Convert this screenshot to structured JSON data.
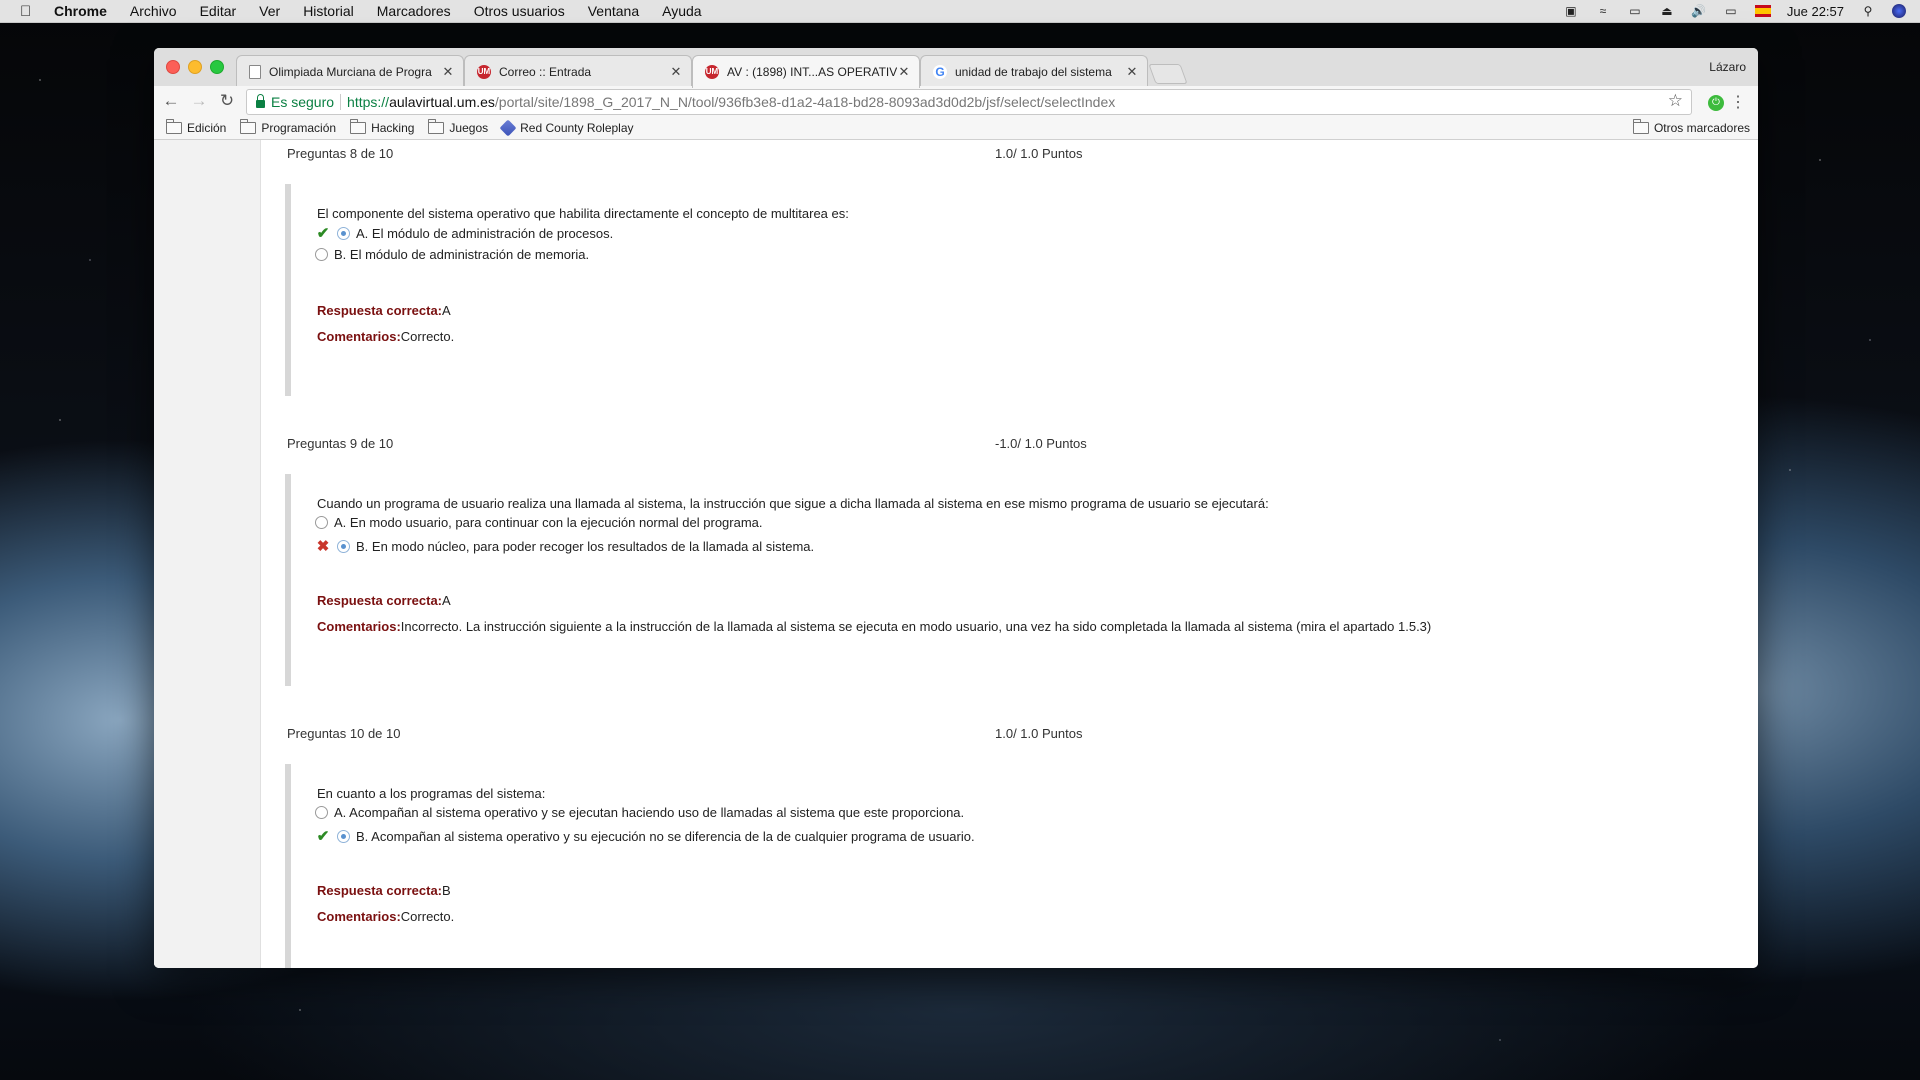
{
  "menubar": {
    "app": "Chrome",
    "items": [
      "Archivo",
      "Editar",
      "Ver",
      "Historial",
      "Marcadores",
      "Otros usuarios",
      "Ventana",
      "Ayuda"
    ],
    "clock": "Jue 22:57"
  },
  "browser": {
    "profile": "Lázaro",
    "tabs": [
      {
        "title": "Olimpiada Murciana de Progra",
        "icon": "document-icon"
      },
      {
        "title": "Correo :: Entrada",
        "icon": "um-icon"
      },
      {
        "title": "AV : (1898) INT...AS OPERATIV",
        "icon": "um-icon"
      },
      {
        "title": "unidad de trabajo del sistema",
        "icon": "google-icon"
      }
    ],
    "security_label": "Es seguro",
    "url": {
      "scheme": "https://",
      "host": "aulavirtual.um.es",
      "path": "/portal/site/1898_G_2017_N_N/tool/936fb3e8-d1a2-4a18-bd28-8093ad3d0d2b/jsf/select/selectIndex"
    },
    "bookmarks": [
      "Edición",
      "Programación",
      "Hacking",
      "Juegos",
      "Red County Roleplay"
    ],
    "other_bookmarks": "Otros marcadores"
  },
  "questions": [
    {
      "header": "Preguntas 8 de 10",
      "points": "1.0/ 1.0 Puntos",
      "text": "El componente del sistema operativo que habilita directamente el concepto de multitarea es:",
      "options": [
        {
          "label": "A. El módulo de administración de procesos.",
          "selected": true,
          "mark": "check"
        },
        {
          "label": "B. El módulo de administración de memoria.",
          "selected": false,
          "mark": ""
        }
      ],
      "correct_label": "Respuesta correcta:",
      "correct_value": "A",
      "comments_label": "Comentarios:",
      "comments_value": "Correcto."
    },
    {
      "header": "Preguntas 9 de 10",
      "points": "-1.0/ 1.0 Puntos",
      "text": "Cuando un programa de usuario realiza una llamada al sistema, la instrucción que sigue a dicha llamada al sistema en ese mismo programa de usuario se ejecutará:",
      "options": [
        {
          "label": "A. En modo usuario, para continuar con la ejecución normal del programa.",
          "selected": false,
          "mark": ""
        },
        {
          "label": "B. En modo núcleo, para poder recoger los resultados de la llamada al sistema.",
          "selected": true,
          "mark": "cross"
        }
      ],
      "correct_label": "Respuesta correcta:",
      "correct_value": "A",
      "comments_label": "Comentarios:",
      "comments_value": "Incorrecto. La instrucción siguiente a la instrucción de la llamada al sistema se ejecuta en modo usuario, una vez ha sido completada la llamada al sistema (mira el apartado 1.5.3)"
    },
    {
      "header": "Preguntas 10 de 10",
      "points": "1.0/ 1.0 Puntos",
      "text": "En cuanto a los programas del sistema:",
      "options": [
        {
          "label": "A. Acompañan al sistema operativo y se ejecutan haciendo uso de llamadas al sistema que este proporciona.",
          "selected": false,
          "mark": ""
        },
        {
          "label": "B. Acompañan al sistema operativo y su ejecución no se diferencia de la de cualquier programa de usuario.",
          "selected": true,
          "mark": "check"
        }
      ],
      "correct_label": "Respuesta correcta:",
      "correct_value": "B",
      "comments_label": "Comentarios:",
      "comments_value": "Correcto."
    }
  ],
  "colors": {
    "correct_mark": "#2c8a24",
    "incorrect_mark": "#c9362b",
    "answer_label": "#7a1010",
    "secure_green": "#0b8043"
  }
}
